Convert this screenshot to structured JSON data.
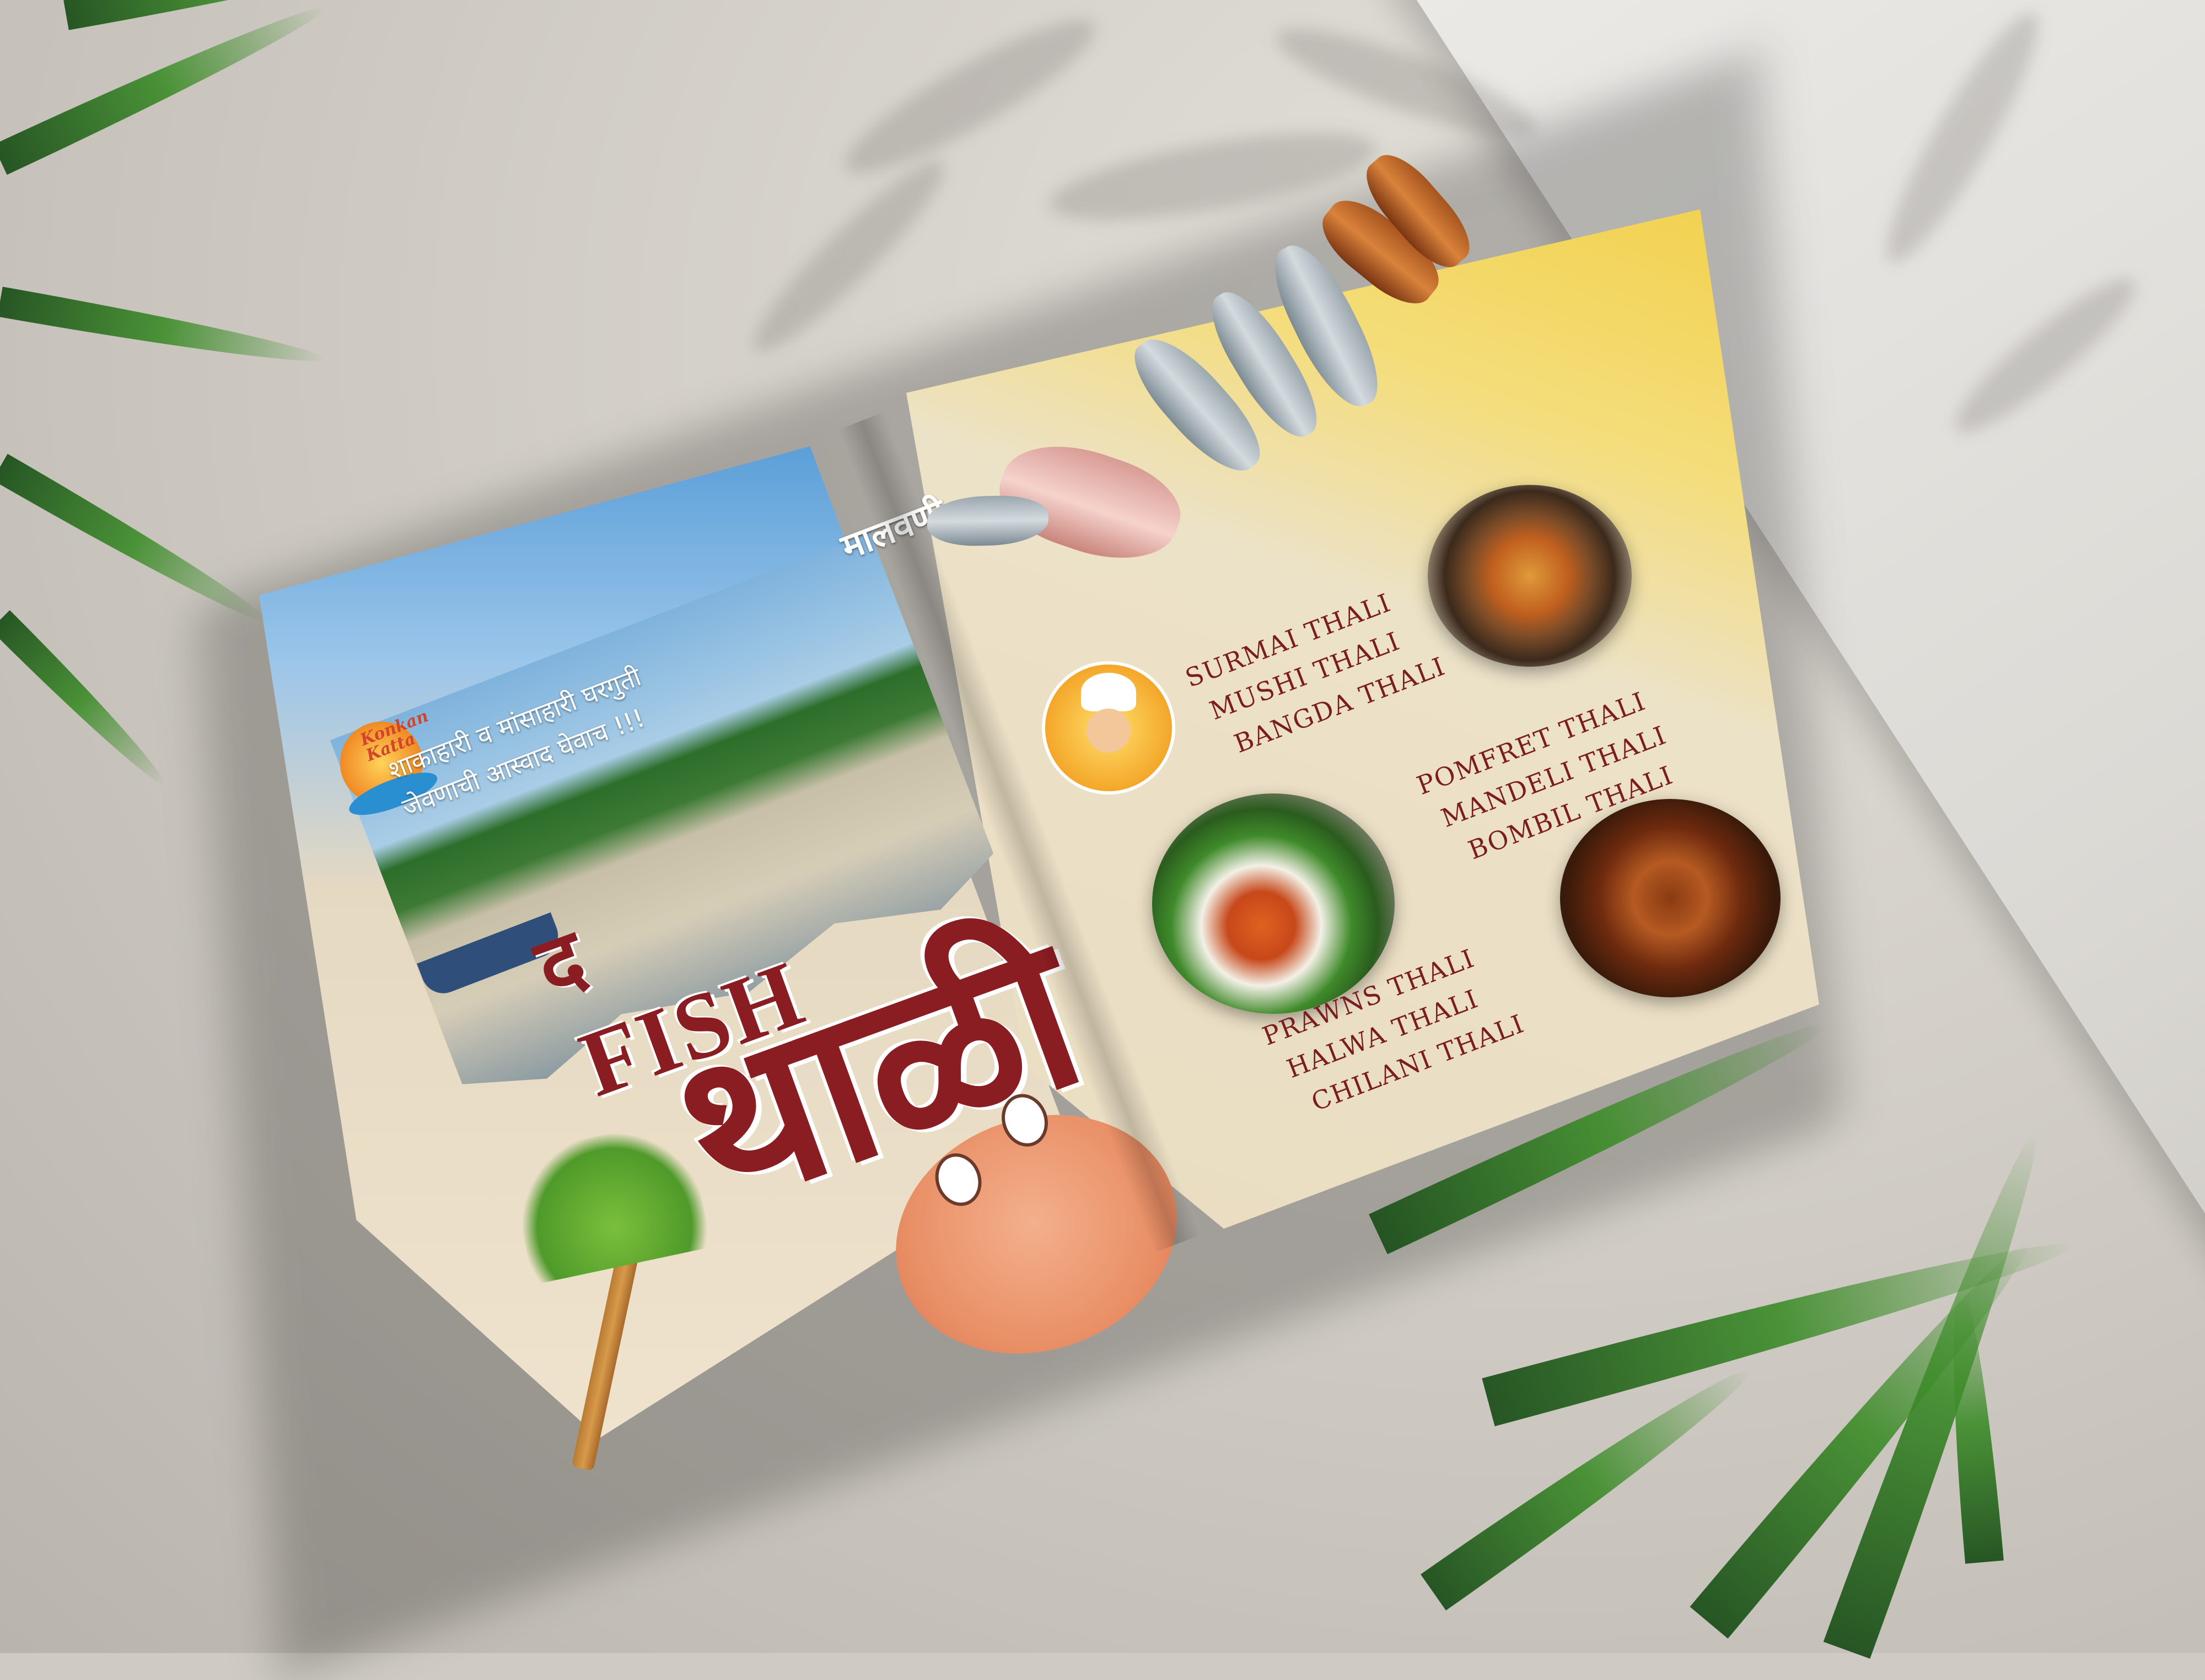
{
  "magazine": {
    "logo": {
      "text": "Konkan Katta"
    },
    "left_page": {
      "tagline_highlight": "मालवणी",
      "tagline_line1": "शाकाहारी व मांसाहारी घरगुती",
      "tagline_line2": "जेवणाची आस्वाद घेवाच !!!",
      "title_the": "द",
      "title_fish": "FISH",
      "title_thali": "थाळी"
    },
    "right_page": {
      "menu_group_1": [
        "SURMAI THALI",
        "MUSHI THALI",
        "BANGDA THALI"
      ],
      "menu_group_2": [
        "POMFRET THALI",
        "MANDELI THALI",
        "BOMBIL THALI"
      ],
      "menu_group_3": [
        "PRAWNS THALI",
        "HALWA THALI",
        "CHILANI THALI"
      ]
    }
  },
  "colors": {
    "title": "#8a1d22",
    "menu_text": "#7a1c20",
    "accent_yellow": "#f2d04a",
    "sky": "#5b9fd8"
  }
}
